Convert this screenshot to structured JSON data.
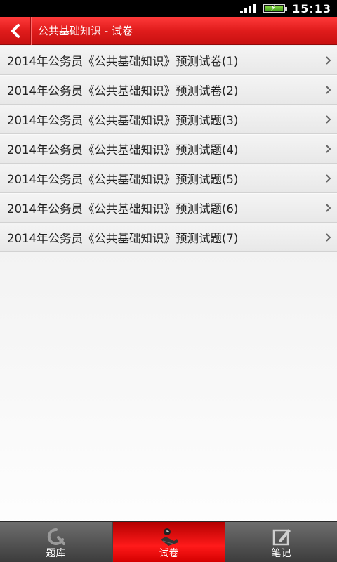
{
  "status_bar": {
    "time": "15:13"
  },
  "header": {
    "title": "公共基础知识 - 试卷"
  },
  "list": {
    "items": [
      {
        "label": "2014年公务员《公共基础知识》预测试卷(1)"
      },
      {
        "label": "2014年公务员《公共基础知识》预测试卷(2)"
      },
      {
        "label": "2014年公务员《公共基础知识》预测试题(3)"
      },
      {
        "label": "2014年公务员《公共基础知识》预测试题(4)"
      },
      {
        "label": "2014年公务员《公共基础知识》预测试题(5)"
      },
      {
        "label": "2014年公务员《公共基础知识》预测试题(6)"
      },
      {
        "label": "2014年公务员《公共基础知识》预测试题(7)"
      }
    ]
  },
  "tabs": [
    {
      "label": "题库",
      "icon": "question-bank-icon",
      "active": false
    },
    {
      "label": "试卷",
      "icon": "exam-paper-icon",
      "active": true
    },
    {
      "label": "笔记",
      "icon": "notes-icon",
      "active": false
    }
  ],
  "colors": {
    "header_red": "#e01c1c",
    "active_tab_red": "#ff1a1a",
    "tabbar_gray": "#4a4a4a"
  }
}
